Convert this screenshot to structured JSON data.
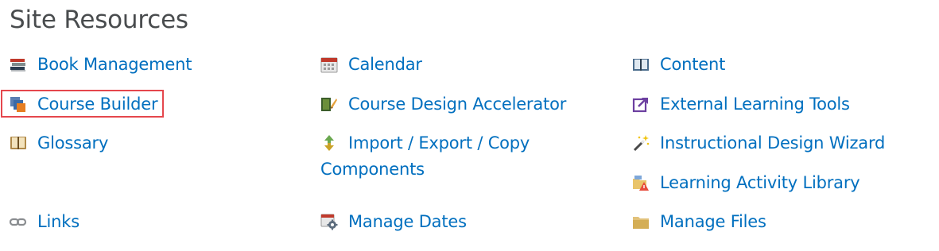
{
  "page": {
    "title": "Site Resources"
  },
  "columns": [
    {
      "items": [
        {
          "label": "Book Management",
          "icon": "books-icon"
        },
        {
          "label": "Course Builder",
          "icon": "course-builder-icon",
          "highlighted": true
        },
        {
          "label": "Glossary",
          "icon": "glossary-book-icon"
        },
        {
          "label": "Links",
          "icon": "chain-link-icon"
        }
      ]
    },
    {
      "items": [
        {
          "label": "Calendar",
          "icon": "calendar-icon"
        },
        {
          "label": "Course Design Accelerator",
          "icon": "design-accelerator-icon"
        },
        {
          "label": "Import / Export / Copy Components",
          "icon": "import-export-arrows-icon"
        },
        {
          "label": "Manage Dates",
          "icon": "calendar-gear-icon"
        }
      ]
    },
    {
      "items": [
        {
          "label": "Content",
          "icon": "open-book-icon"
        },
        {
          "label": "External Learning Tools",
          "icon": "external-tool-icon"
        },
        {
          "label": "Instructional Design Wizard",
          "icon": "magic-wand-icon"
        },
        {
          "label": "Learning Activity Library",
          "icon": "activity-folder-icon"
        },
        {
          "label": "Manage Files",
          "icon": "folder-icon"
        }
      ]
    }
  ],
  "colors": {
    "link": "#006fbf",
    "title": "#494c4e",
    "highlight_border": "#e5474d"
  }
}
